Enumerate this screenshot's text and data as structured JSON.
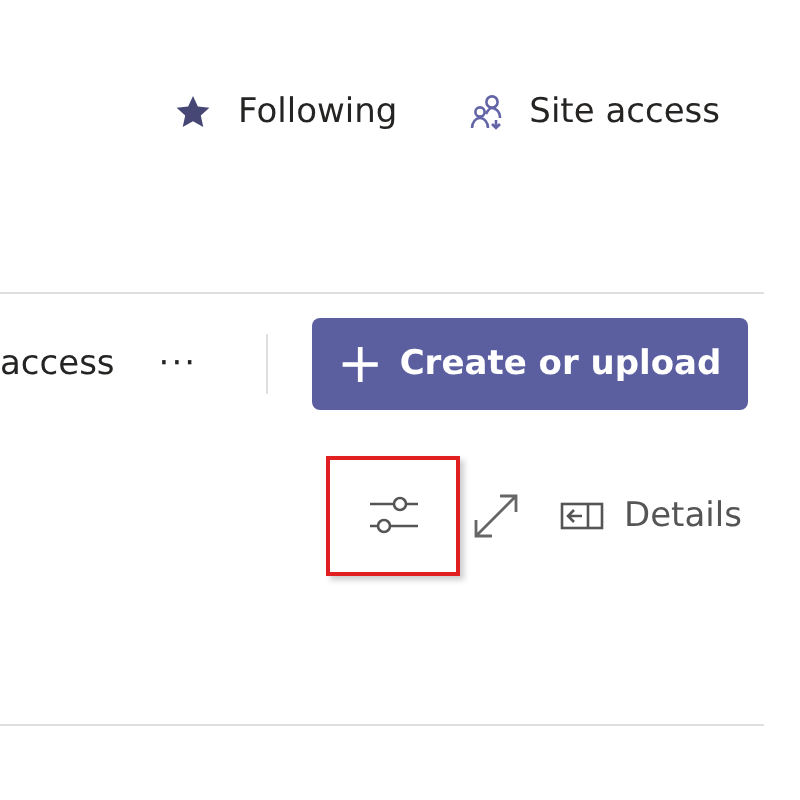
{
  "header": {
    "following": {
      "label": "Following"
    },
    "site_access": {
      "label": "Site access"
    }
  },
  "toolbar": {
    "cut_item": "access",
    "more": "···",
    "create_button": {
      "icon": "+",
      "label": "Create or upload"
    }
  },
  "view_bar": {
    "filter_highlighted": true,
    "details": {
      "label": "Details"
    }
  }
}
